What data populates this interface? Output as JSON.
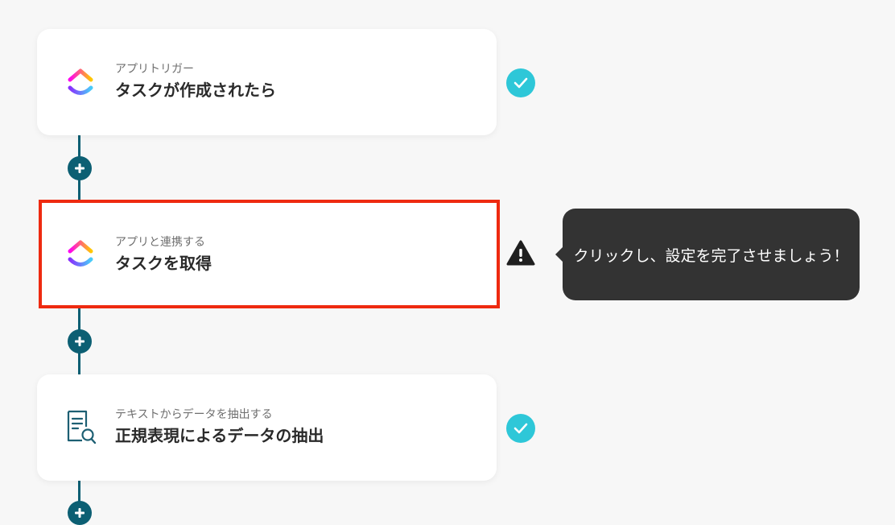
{
  "flow": {
    "steps": [
      {
        "subtitle": "アプリトリガー",
        "title": "タスクが作成されたら",
        "icon": "clickup-logo-icon",
        "status": "complete"
      },
      {
        "subtitle": "アプリと連携する",
        "title": "タスクを取得",
        "icon": "clickup-logo-icon",
        "status": "warning"
      },
      {
        "subtitle": "テキストからデータを抽出する",
        "title": "正規表現によるデータの抽出",
        "icon": "document-search-icon",
        "status": "complete"
      }
    ],
    "add_step_icon": "plus-icon"
  },
  "tooltip": {
    "text": "クリックし、設定を完了させましょう！"
  },
  "colors": {
    "connector": "#0c5f73",
    "check_badge": "#2ec7d8",
    "highlight_border": "#ee2a10",
    "tooltip_bg": "#333333",
    "background": "#f7f7f7"
  }
}
